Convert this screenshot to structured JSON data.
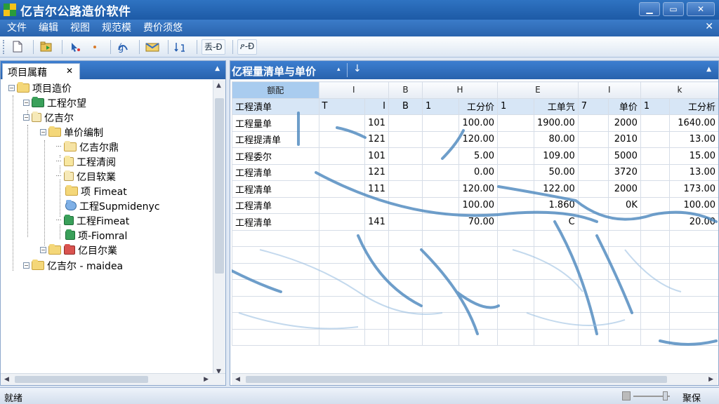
{
  "window": {
    "title": "亿吉尔公路造价软件",
    "min": "▁",
    "max": "▭",
    "close": "✕"
  },
  "menu": [
    "文件",
    "编辑",
    "视图",
    "规范模",
    "费价须悠"
  ],
  "toolbar": {
    "btn1": "丢-Ð",
    "btn2": "ዖ-Ð"
  },
  "left_panel": {
    "tab": "项目属藉",
    "tree": [
      {
        "label": "项目造价"
      },
      {
        "label": "工程尔望"
      },
      {
        "label": "亿吉尔"
      },
      {
        "label": "单价编制"
      },
      {
        "label": "亿吉尔鼎"
      },
      {
        "label": "工程清阅"
      },
      {
        "label": "亿目软業"
      },
      {
        "label": "项 Fimeat"
      },
      {
        "label": "工程Supmidenyc"
      },
      {
        "label": "工程Fimeat"
      },
      {
        "label": "项-Fiomral"
      },
      {
        "label": "亿目尔業"
      },
      {
        "label": "亿吉尔 - maidea"
      }
    ]
  },
  "right_panel": {
    "tab_title": "亿程量清单与单价",
    "columns": [
      "额配",
      "I",
      "B",
      "H",
      "E",
      "I",
      "k"
    ],
    "header_row": [
      "工程漬单",
      "T",
      "I",
      "B",
      "1",
      "工分价",
      "1",
      "工单氕",
      "7",
      "单价",
      "1",
      "工分析"
    ],
    "rows": [
      {
        "name": "工程量单",
        "a": "101",
        "b": "",
        "c": "100.00",
        "d": "1900.00",
        "e": "2000",
        "f": "1640.00"
      },
      {
        "name": "工程提清单",
        "a": "121",
        "b": "",
        "c": "120.00",
        "d": "80.00",
        "e": "2010",
        "f": "13.00"
      },
      {
        "name": "工程委尔",
        "a": "101",
        "b": "",
        "c": "5.00",
        "d": "109.00",
        "e": "5000",
        "f": "15.00"
      },
      {
        "name": "工程清单",
        "a": "121",
        "b": "",
        "c": "0.00",
        "d": "50.00",
        "e": "3720",
        "f": "13.00"
      },
      {
        "name": "工程凊单",
        "a": "111",
        "b": "",
        "c": "120.00",
        "d": "122.00",
        "e": "2000",
        "f": "173.00"
      },
      {
        "name": "工程清单",
        "a": "",
        "b": "",
        "c": "100.00",
        "d": "1.860",
        "e": "0K",
        "f": "100.00"
      },
      {
        "name": "工程清单",
        "a": "141",
        "b": "",
        "c": "70.00",
        "d": "C",
        "e": "",
        "f": "20.00"
      }
    ]
  },
  "status": {
    "left": "就绪",
    "right": "聚保"
  },
  "colors": {
    "title_bar": "#1d5aa6",
    "panel_tab": "#2862ad",
    "header_row": "#d7e6f6",
    "selected_col": "#a9ccef",
    "decor_stroke": "#4a86bd"
  }
}
